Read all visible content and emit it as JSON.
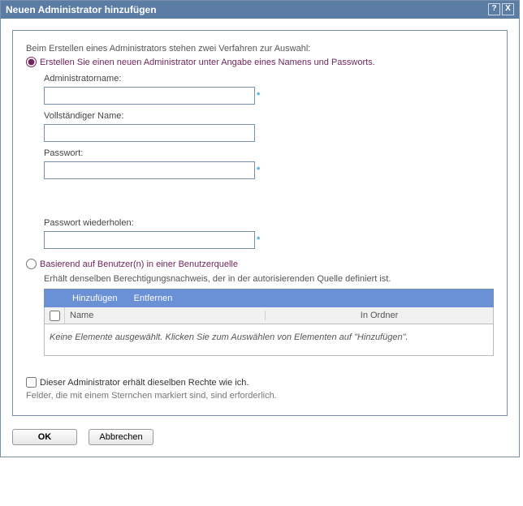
{
  "titlebar": {
    "title": "Neuen Administrator hinzufügen",
    "help_icon": "?",
    "close_icon": "X"
  },
  "intro": "Beim Erstellen eines Administrators stehen zwei Verfahren zur Auswahl:",
  "option1": {
    "label": "Erstellen Sie einen neuen Administrator unter Angabe eines Namens und Passworts.",
    "fields": {
      "admin_name_label": "Administratorname:",
      "admin_name_value": "",
      "full_name_label": "Vollständiger Name:",
      "full_name_value": "",
      "password_label": "Passwort:",
      "password_value": "",
      "password_repeat_label": "Passwort wiederholen:",
      "password_repeat_value": "",
      "asterisk": "*"
    }
  },
  "option2": {
    "label": "Basierend auf Benutzer(n) in einer Benutzerquelle",
    "desc": "Erhält denselben Berechtigungsnachweis, der in der autorisierenden Quelle definiert ist.",
    "toolbar": {
      "add": "Hinzufügen",
      "remove": "Entfernen"
    },
    "columns": {
      "name": "Name",
      "folder": "In Ordner"
    },
    "empty_text": "Keine Elemente ausgewählt. Klicken Sie zum Auswählen von Elementen auf \"Hinzufügen\"."
  },
  "same_rights": {
    "label": "Dieser Administrator erhält dieselben Rechte wie ich."
  },
  "required_note": "Felder, die mit einem Sternchen markiert sind, sind erforderlich.",
  "buttons": {
    "ok": "OK",
    "cancel": "Abbrechen"
  }
}
